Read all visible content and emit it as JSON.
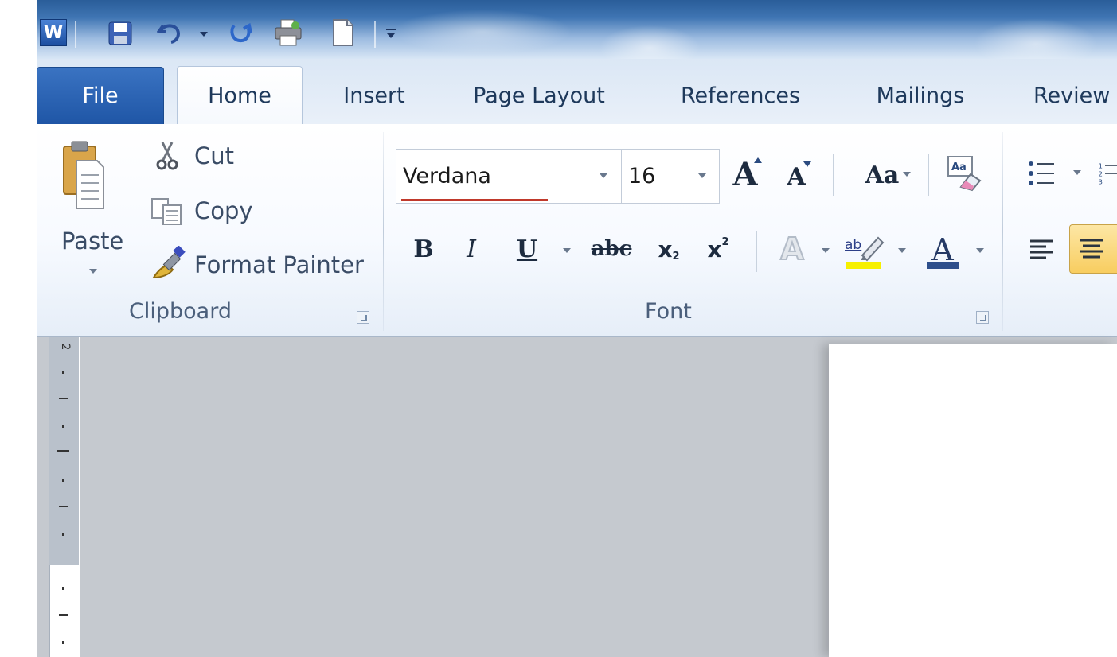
{
  "quick_access": {
    "app_icon": "word-icon",
    "items": [
      "save-icon",
      "undo-icon",
      "redo-icon",
      "print-icon",
      "new-document-icon",
      "customize-qat-icon"
    ]
  },
  "tabs": [
    {
      "label": "File"
    },
    {
      "label": "Home"
    },
    {
      "label": "Insert"
    },
    {
      "label": "Page Layout"
    },
    {
      "label": "References"
    },
    {
      "label": "Mailings"
    },
    {
      "label": "Review"
    }
  ],
  "clipboard": {
    "paste_label": "Paste",
    "cut_label": "Cut",
    "copy_label": "Copy",
    "format_painter_label": "Format Painter",
    "group_label": "Clipboard"
  },
  "font": {
    "font_name": "Verdana",
    "font_size": "16",
    "group_label": "Font",
    "change_case_label": "Aa",
    "bold_label": "B",
    "italic_label": "I",
    "underline_label": "U",
    "strikethrough_label": "abc",
    "subscript_label": "x",
    "superscript_label": "x",
    "highlight_label": "ab",
    "font_color_label": "A",
    "grow_label": "A",
    "shrink_label": "A",
    "text_effects_label": "A"
  },
  "colors": {
    "file_tab": "#2b63b4",
    "highlight_yellow": "#f6f000",
    "font_color_bar": "#2e4f8c",
    "spellcheck_underline": "#c0392b",
    "active_align": "#fbd778"
  }
}
